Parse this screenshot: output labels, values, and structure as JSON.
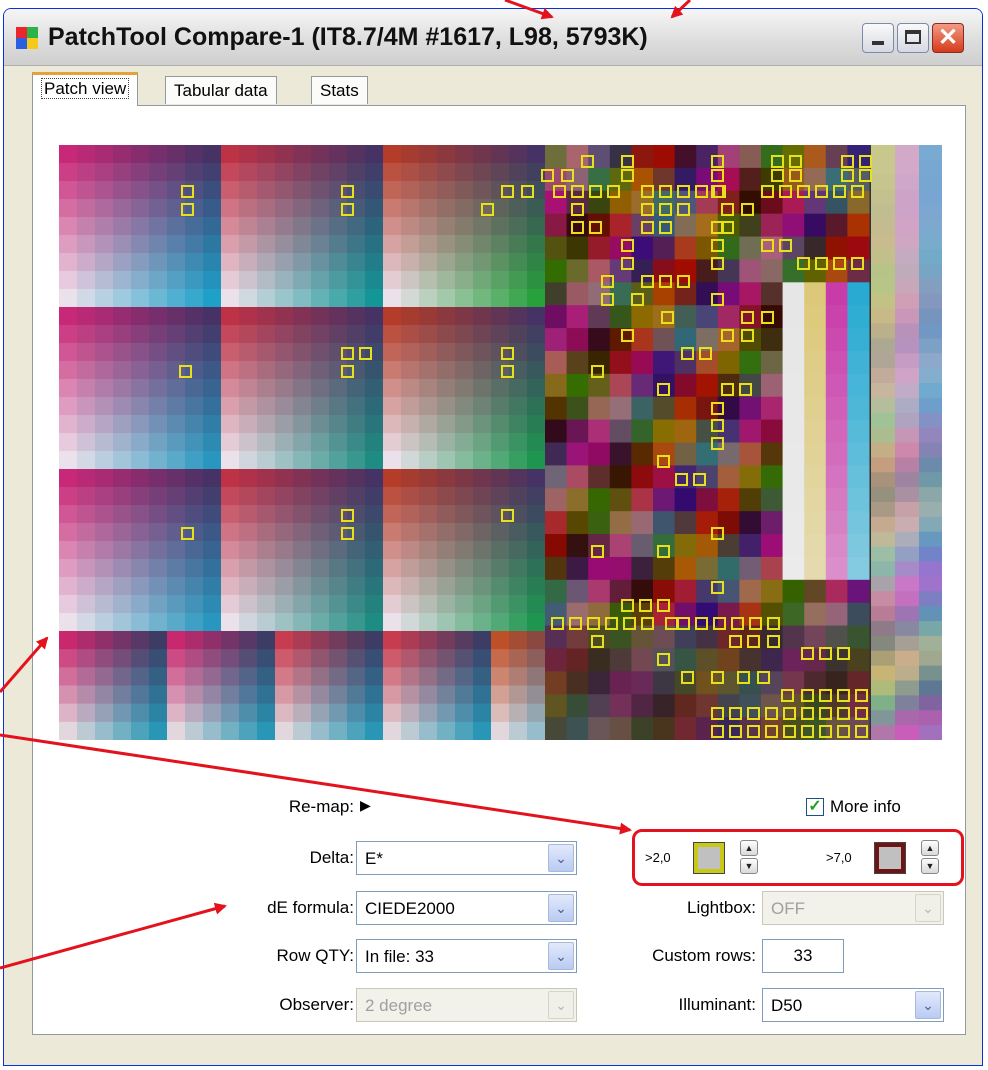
{
  "window": {
    "title": "PatchTool Compare-1 (IT8.7/4M #1617, L98, 5793K)",
    "controls": {
      "minimize": "_",
      "maximize": "□",
      "close": "✕"
    }
  },
  "tabs": [
    {
      "label": "Patch view",
      "active": true
    },
    {
      "label": "Tabular data",
      "active": false
    },
    {
      "label": "Stats",
      "active": false
    }
  ],
  "remap": {
    "label": "Re-map:",
    "icon": "triangle-right-icon",
    "glyph": "▶"
  },
  "more_info": {
    "label": "More info",
    "checked": true,
    "glyph": "✓"
  },
  "delta": {
    "label": "Delta:",
    "value": "E*"
  },
  "threshold_low": {
    "label": ">2,0",
    "color": "#c8c816"
  },
  "threshold_high": {
    "label": ">7,0",
    "color": "#6e1414"
  },
  "de_formula": {
    "label": "dE formula:",
    "value": "CIEDE2000"
  },
  "lightbox": {
    "label": "Lightbox:",
    "value": "OFF",
    "enabled": false
  },
  "row_qty": {
    "label": "Row QTY:",
    "value": "In file: 33"
  },
  "custom_rows": {
    "label": "Custom rows:",
    "value": "33"
  },
  "observer": {
    "label": "Observer:",
    "value": "2 degree",
    "enabled": false
  },
  "illuminant": {
    "label": "Illuminant:",
    "value": "D50"
  },
  "annotation_color": "#e3121d",
  "flag_color": "#e8e01a",
  "chevron_glyph": "⌄",
  "spin_glyphs": {
    "up": "▲",
    "down": "▼"
  }
}
